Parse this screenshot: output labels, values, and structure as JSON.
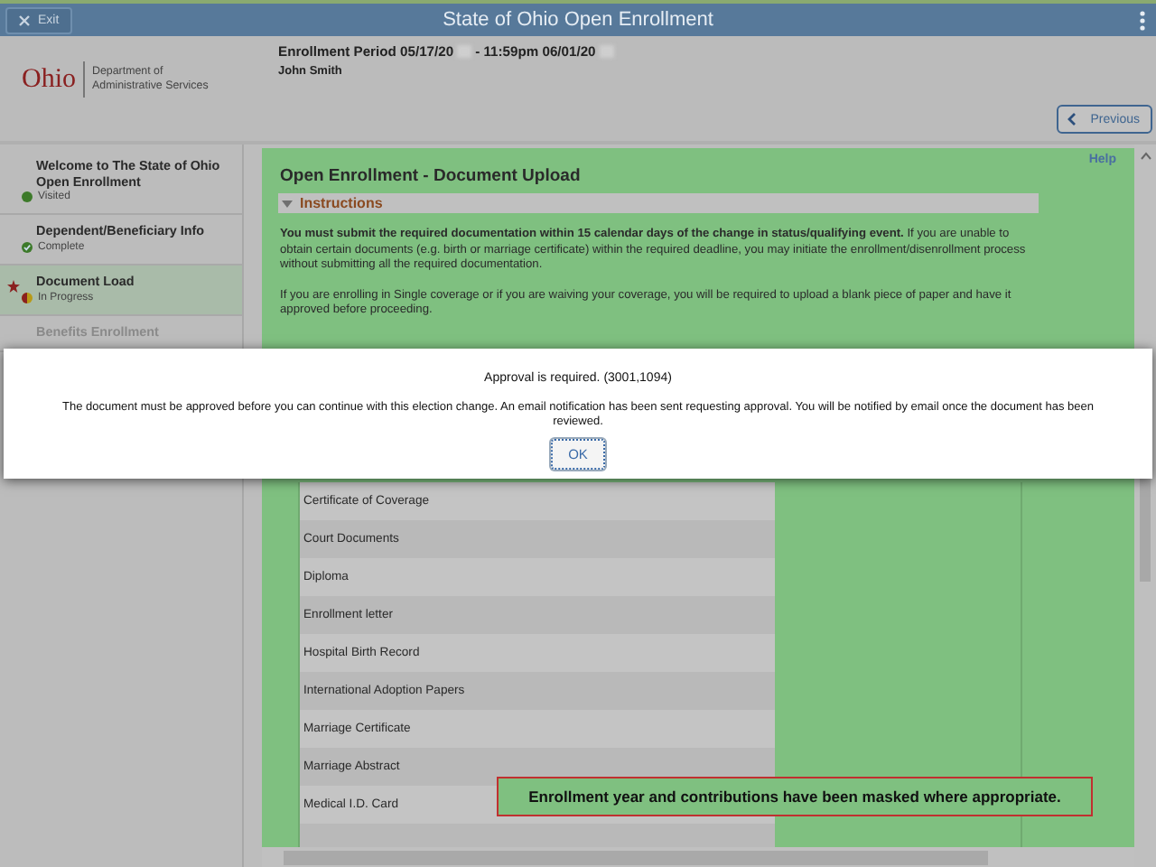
{
  "window": {
    "title": "State of Ohio Open Enrollment",
    "exit": "Exit"
  },
  "header": {
    "logo": "Ohio",
    "department": "Department of Administrative Services",
    "period_label": "Enrollment Period 05/17/20",
    "period_mid": "- 11:59pm 06/01/20",
    "name": "John Smith",
    "previous": "Previous"
  },
  "sidebar": {
    "items": [
      {
        "title": "Welcome to The State of Ohio Open Enrollment",
        "status": "Visited",
        "kind": "visited",
        "selected": false
      },
      {
        "title": "Dependent/Beneficiary Info",
        "status": "Complete",
        "kind": "complete",
        "selected": false
      },
      {
        "title": "Document Load",
        "status": "In Progress",
        "kind": "in_progress",
        "selected": true
      },
      {
        "title": "Benefits Enrollment",
        "kind": "pending",
        "selected": false
      }
    ]
  },
  "page": {
    "title": "Open Enrollment - Document Upload",
    "help": "Help",
    "section": "Instructions",
    "paragraphs": [
      "**You must submit the required documentation within 15 calendar days of the change in status/qualifying event.** If you are unable to obtain certain documents (e.g. birth or marriage certificate) within the required deadline, you may initiate the enrollment/disenrollment process without submitting all the required documentation.",
      "If you are enrolling in Single coverage or if you are waiving your coverage, you will be required to upload a blank piece of paper and have it approved before proceeding."
    ],
    "documents": [
      "Certificate of Coverage",
      "Court Documents",
      "Diploma",
      "Enrollment letter",
      "Hospital Birth Record",
      "International Adoption Papers",
      "Marriage Certificate",
      "Marriage Abstract",
      "Medical I.D. Card"
    ]
  },
  "dialog": {
    "title": "Approval is required. (3001,1094)",
    "message": "The document must be approved before you can continue with this election change. An email notification has been sent requesting approval. You will be notified by email once the document has been reviewed.",
    "ok": "OK"
  },
  "note": "Enrollment year and contributions have been masked where appropriate."
}
